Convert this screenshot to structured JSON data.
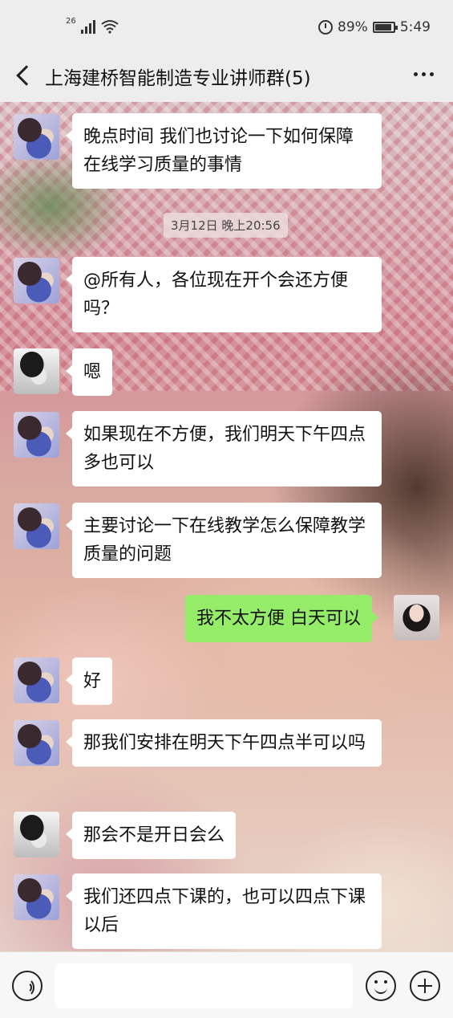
{
  "status_bar": {
    "network": "26",
    "battery": "89%",
    "time": "5:49"
  },
  "header": {
    "title": "上海建桥智能制造专业讲师群(5)"
  },
  "timestamp": "3月12日 晚上20:56",
  "messages": [
    {
      "sender": "other",
      "avatar": "boy-avatar",
      "text": "晚点时间   我们也讨论一下如何保障在线学习质量的事情"
    },
    {
      "sender": "other",
      "avatar": "boy-avatar",
      "text": "@所有人，各位现在开个会还方便吗？"
    },
    {
      "sender": "other",
      "avatar": "girl-avatar",
      "text": "嗯"
    },
    {
      "sender": "other",
      "avatar": "boy-avatar",
      "text": "如果现在不方便，我们明天下午四点多也可以"
    },
    {
      "sender": "other",
      "avatar": "boy-avatar",
      "text": "主要讨论一下在线教学怎么保障教学质量的问题"
    },
    {
      "sender": "me",
      "avatar": "my-avatar",
      "text": "我不太方便 白天可以"
    },
    {
      "sender": "other",
      "avatar": "boy-avatar",
      "text": "好"
    },
    {
      "sender": "other",
      "avatar": "boy-avatar",
      "text": "那我们安排在明天下午四点半可以吗"
    },
    {
      "sender": "other",
      "avatar": "girl-avatar",
      "text": "那会不是开日会么"
    },
    {
      "sender": "other",
      "avatar": "boy-avatar",
      "text": "我们还四点下课的，也可以四点下课以后"
    }
  ],
  "input": {
    "value": "",
    "placeholder": ""
  },
  "colors": {
    "my_bubble": "#95ec69",
    "other_bubble": "#ffffff",
    "header_bg": "#ededed"
  }
}
